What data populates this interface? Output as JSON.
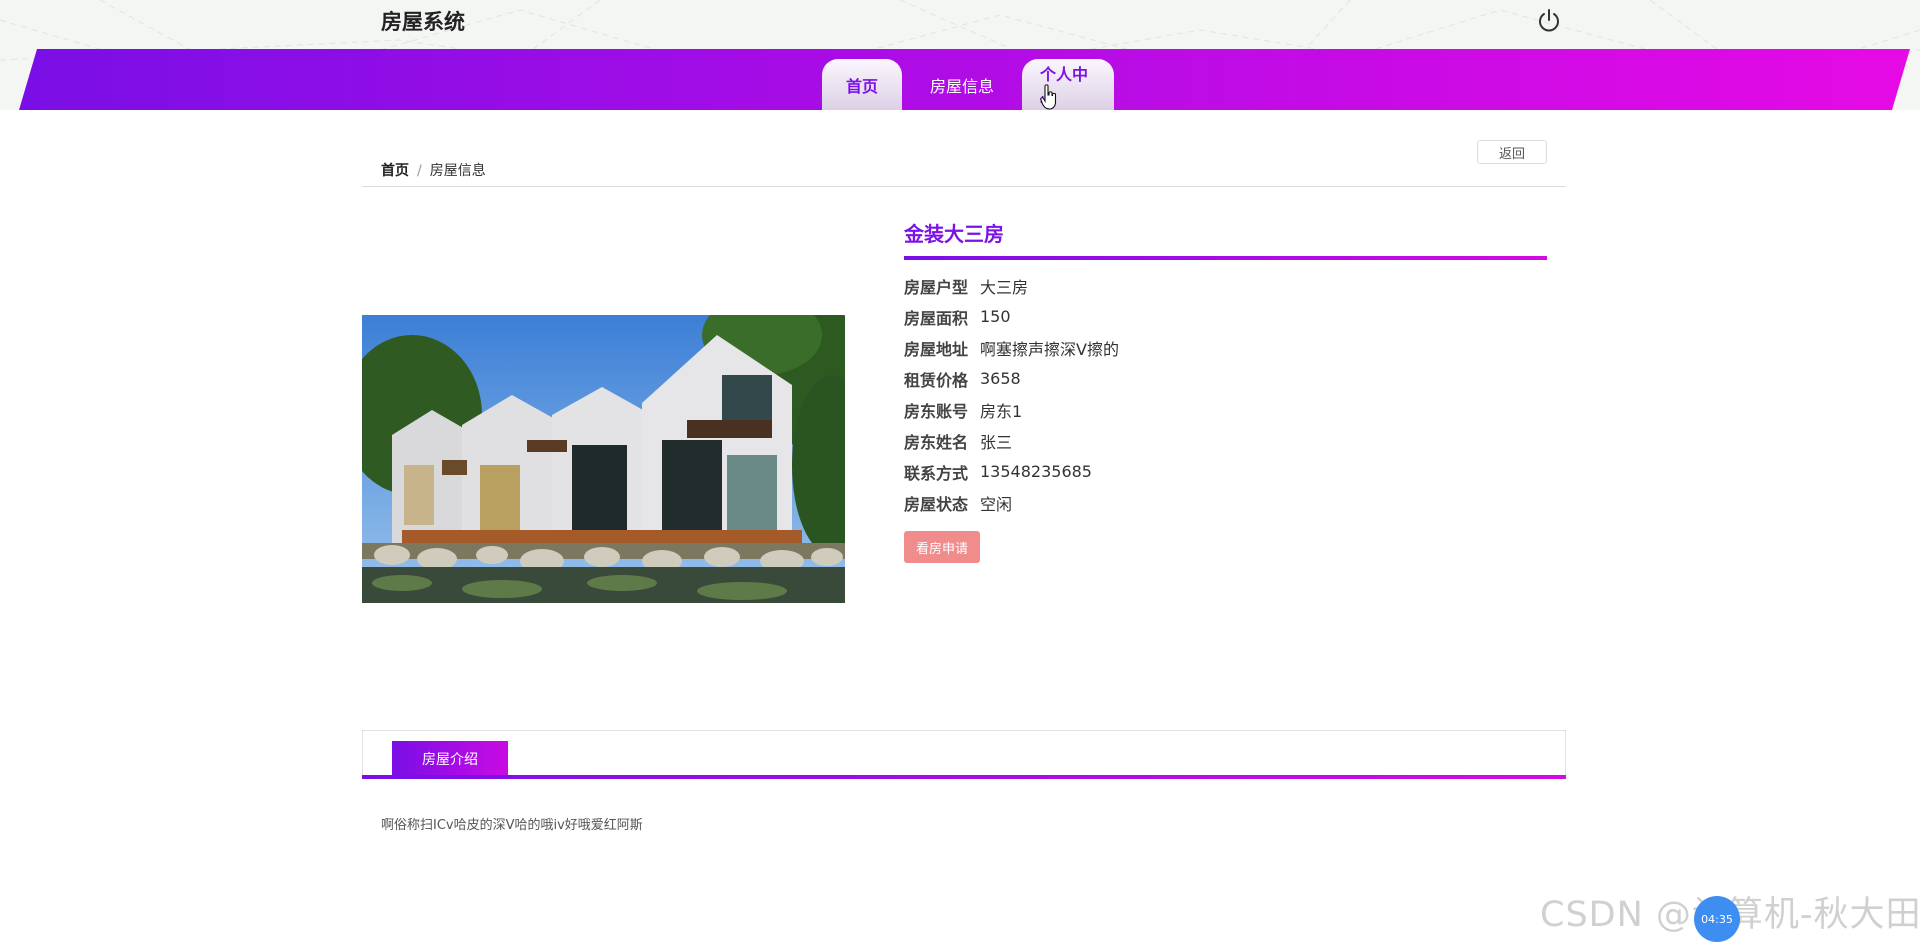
{
  "header": {
    "brand": "房屋系统",
    "power_icon": "power-icon",
    "nav": [
      {
        "label": "首页",
        "active": true
      },
      {
        "label": "房屋信息",
        "active": false
      },
      {
        "label": "个人中心",
        "active": true
      }
    ],
    "gradient_start": "#7a0ee6",
    "gradient_end": "#e60ae5"
  },
  "breadcrumb": {
    "home": "首页",
    "separator": "/",
    "current": "房屋信息"
  },
  "back_button": "返回",
  "house": {
    "title": "金装大三房",
    "fields": [
      {
        "label": "房屋户型",
        "value": "大三房"
      },
      {
        "label": "房屋面积",
        "value": "150"
      },
      {
        "label": "房屋地址",
        "value": "啊塞擦声擦深V擦的"
      },
      {
        "label": "租赁价格",
        "value": "3658"
      },
      {
        "label": "房东账号",
        "value": "房东1"
      },
      {
        "label": "房东姓名",
        "value": "张三"
      },
      {
        "label": "联系方式",
        "value": "13548235685"
      },
      {
        "label": "房屋状态",
        "value": "空闲"
      }
    ],
    "apply_button": "看房申请",
    "apply_color": "#f08c8c"
  },
  "tabs": {
    "intro_label": "房屋介绍"
  },
  "description": "啊俗称扫ICv哈皮的深V哈的哦iv好哦爱红阿斯",
  "overlay": {
    "watermark": "CSDN @计算机-秋大田",
    "timer": "04:35"
  }
}
